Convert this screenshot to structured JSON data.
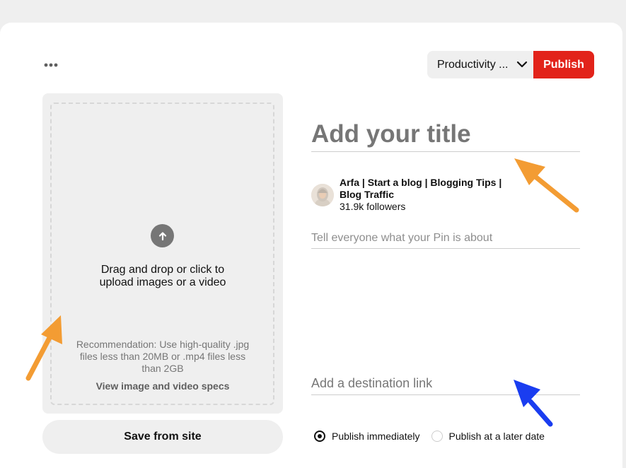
{
  "toolbar": {
    "more_icon": "more-horizontal-icon",
    "board_select_value": "Productivity ...",
    "chevron_icon": "chevron-down-icon",
    "publish_label": "Publish"
  },
  "upload": {
    "icon": "upload-arrow-icon",
    "instruction_line1": "Drag and drop or click to",
    "instruction_line2": "upload images or a video",
    "recommendation_line1": "Recommendation: Use high-quality .jpg",
    "recommendation_line2": "files less than 20MB or .mp4 files less",
    "recommendation_line3": "than 2GB",
    "specs_link": "View image and video specs",
    "save_from_site_label": "Save from site"
  },
  "form": {
    "title_placeholder": "Add your title",
    "profile_name_line1": "Arfa | Start a blog | Blogging Tips |",
    "profile_name_line2": "Blog Traffic",
    "profile_followers": "31.9k followers",
    "description_placeholder": "Tell everyone what your Pin is about",
    "link_placeholder": "Add a destination link"
  },
  "publish_options": {
    "immediately_label": "Publish immediately",
    "later_label": "Publish at a later date",
    "selected": "immediately"
  },
  "colors": {
    "publish_red": "#e2231a",
    "orange_arrow": "#f39c33",
    "blue_arrow": "#1a3df0"
  }
}
